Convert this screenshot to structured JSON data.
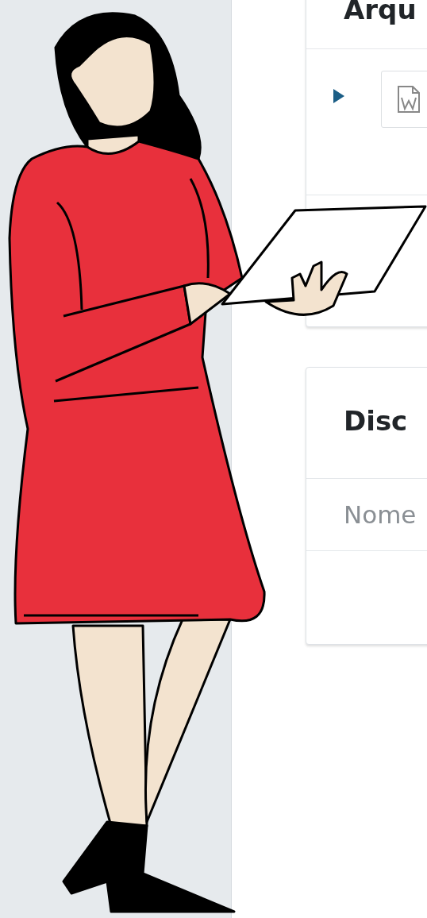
{
  "files_card": {
    "title": "Arqu",
    "file_row": {
      "expanded": false
    }
  },
  "discussion_card": {
    "title": "Disc",
    "columns": [
      "Nome"
    ]
  }
}
